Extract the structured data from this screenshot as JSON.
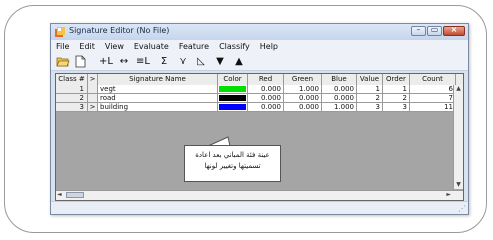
{
  "window": {
    "title": "Signature Editor (No File)"
  },
  "menu": [
    "File",
    "Edit",
    "View",
    "Evaluate",
    "Feature",
    "Classify",
    "Help"
  ],
  "toolbar": {
    "open_icon": "folder-open-icon",
    "new_icon": "new-document-icon",
    "t1": "+L",
    "t2": "↔",
    "t3": "≡L",
    "t4": "Σ",
    "t5": "⋎",
    "t6": "◺",
    "t7": "▼",
    "t8": "▲"
  },
  "table": {
    "headers": [
      "Class #",
      ">",
      "Signature Name",
      "Color",
      "Red",
      "Green",
      "Blue",
      "Value",
      "Order",
      "Count"
    ],
    "rows": [
      {
        "class": "1",
        "marker": "",
        "name": "vegt",
        "color": "#00e000",
        "red": "0.000",
        "green": "1.000",
        "blue": "0.000",
        "value": "1",
        "order": "1",
        "count": "6"
      },
      {
        "class": "2",
        "marker": "",
        "name": "road",
        "color": "#000000",
        "red": "0.000",
        "green": "0.000",
        "blue": "0.000",
        "value": "2",
        "order": "2",
        "count": "7"
      },
      {
        "class": "3",
        "marker": ">",
        "name": "building",
        "color": "#0000ff",
        "red": "0.000",
        "green": "0.000",
        "blue": "1.000",
        "value": "3",
        "order": "3",
        "count": "11"
      }
    ]
  },
  "callout": {
    "line1": "عينة فئة المباني بعد اعادة",
    "line2": "تسميتها وتغيير لونها"
  }
}
